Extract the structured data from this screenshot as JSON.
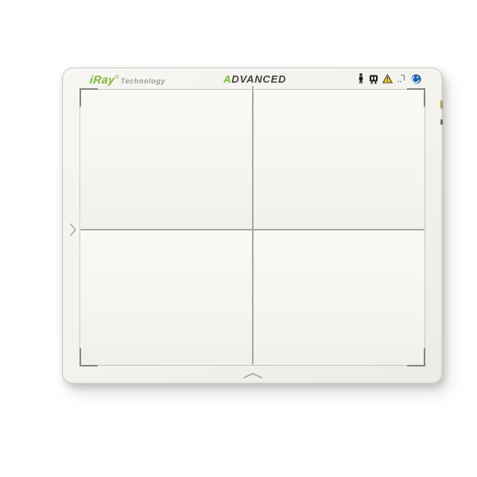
{
  "device": {
    "type": "flat-panel-xray-detector",
    "brand": {
      "name": "iRay",
      "suffix": "Technology",
      "registered": "®"
    },
    "model": "ADVANCED",
    "header_icons": [
      {
        "name": "person-icon",
        "glyph": "standing person silhouette",
        "color": "#1c1c1c"
      },
      {
        "name": "handle-with-care-icon",
        "glyph": "panel handling pictogram",
        "color": "#1c1c1c"
      },
      {
        "name": "warning-triangle-icon",
        "glyph": "warning triangle",
        "color": "#eecf1c"
      },
      {
        "name": "xray-source-icon",
        "glyph": "x-ray source with focal dots",
        "color": "#8b8984"
      },
      {
        "name": "follow-instructions-icon",
        "glyph": "blue circle follow-instructions mark",
        "color": "#1d63b5"
      }
    ],
    "markers": {
      "left_arrow": "›",
      "bottom_arrow": "⌃",
      "corner_brackets": 4,
      "crosshair": "2x2 quadrant grid"
    },
    "colors": {
      "brand_green": "#7cb82f",
      "body": "#f3f2ed",
      "panel_face": "#f7f6f1",
      "grid_line": "#a9a7a0",
      "bracket_gray": "#87857f",
      "text_dark": "#45443f",
      "warning_yellow": "#eecf1c",
      "icon_blue": "#1d63b5"
    }
  }
}
